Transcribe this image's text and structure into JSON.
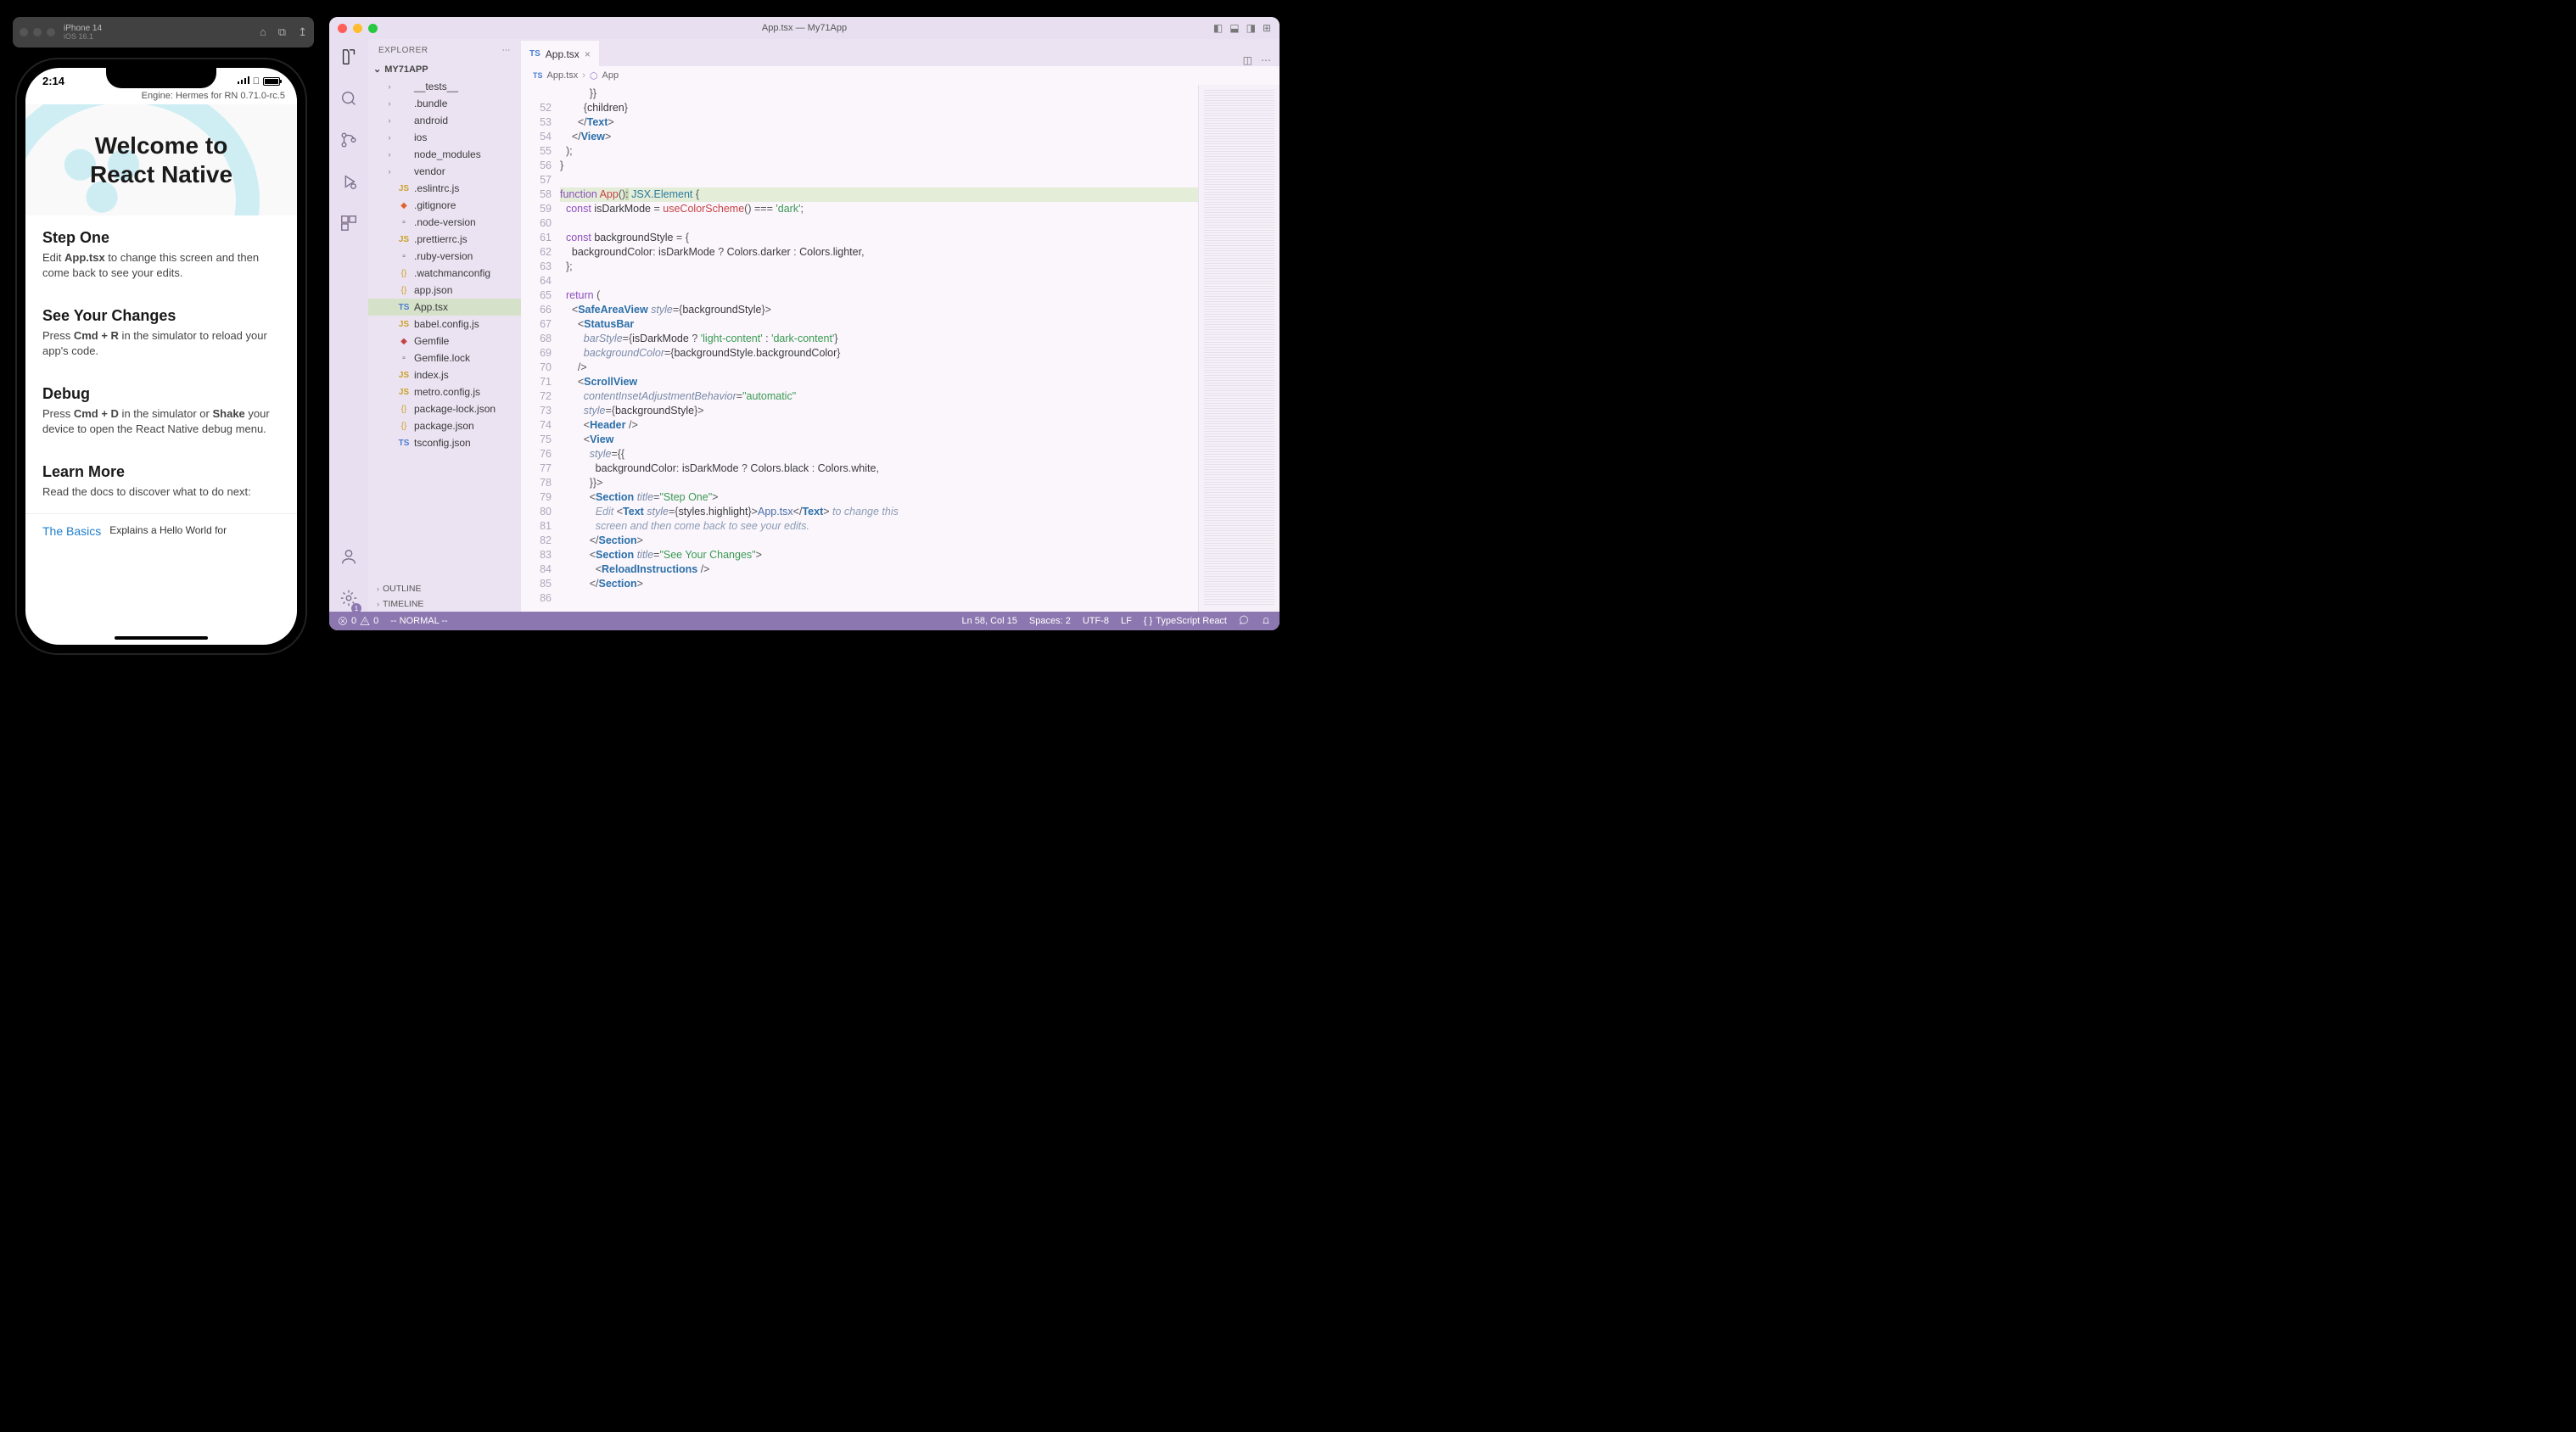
{
  "simulator": {
    "device": "iPhone 14",
    "os": "iOS 16.1"
  },
  "phone": {
    "time": "2:14",
    "engine": "Engine: Hermes for RN 0.71.0-rc.5",
    "hero_l1": "Welcome to",
    "hero_l2": "React Native",
    "sections": [
      {
        "title": "Step One",
        "body_pre": "Edit ",
        "body_b1": "App.tsx",
        "body_post": " to change this screen and then come back to see your edits."
      },
      {
        "title": "See Your Changes",
        "body_pre": "Press ",
        "body_b1": "Cmd + R",
        "body_post": " in the simulator to reload your app's code."
      },
      {
        "title": "Debug",
        "body_pre": "Press ",
        "body_b1": "Cmd + D",
        "body_mid": " in the simulator or ",
        "body_b2": "Shake",
        "body_post": " your device to open the React Native debug menu."
      },
      {
        "title": "Learn More",
        "body_pre": "Read the docs to discover what to do next:",
        "body_b1": "",
        "body_post": ""
      }
    ],
    "footer_link": "The Basics",
    "footer_desc": "Explains a Hello World for"
  },
  "vscode": {
    "title": "App.tsx — My71App",
    "explorer_label": "EXPLORER",
    "project": "MY71APP",
    "outline_label": "OUTLINE",
    "timeline_label": "TIMELINE",
    "tree": [
      {
        "name": "__tests__",
        "kind": "folder"
      },
      {
        "name": ".bundle",
        "kind": "folder"
      },
      {
        "name": "android",
        "kind": "folder"
      },
      {
        "name": "ios",
        "kind": "folder"
      },
      {
        "name": "node_modules",
        "kind": "folder"
      },
      {
        "name": "vendor",
        "kind": "folder"
      },
      {
        "name": ".eslintrc.js",
        "kind": "js"
      },
      {
        "name": ".gitignore",
        "kind": "git"
      },
      {
        "name": ".node-version",
        "kind": "file"
      },
      {
        "name": ".prettierrc.js",
        "kind": "js"
      },
      {
        "name": ".ruby-version",
        "kind": "file"
      },
      {
        "name": ".watchmanconfig",
        "kind": "json"
      },
      {
        "name": "app.json",
        "kind": "json"
      },
      {
        "name": "App.tsx",
        "kind": "ts",
        "selected": true
      },
      {
        "name": "babel.config.js",
        "kind": "js"
      },
      {
        "name": "Gemfile",
        "kind": "rb"
      },
      {
        "name": "Gemfile.lock",
        "kind": "file"
      },
      {
        "name": "index.js",
        "kind": "js"
      },
      {
        "name": "metro.config.js",
        "kind": "js"
      },
      {
        "name": "package-lock.json",
        "kind": "json"
      },
      {
        "name": "package.json",
        "kind": "json"
      },
      {
        "name": "tsconfig.json",
        "kind": "ts"
      }
    ],
    "tab": {
      "name": "App.tsx"
    },
    "breadcrumb": {
      "file": "App.tsx",
      "symbol": "App"
    },
    "line_start": 52,
    "line_count": 35,
    "code_html": [
      "        <span class='op'>{</span>children<span class='op'>}</span>",
      "      <span class='op'>&lt;/</span><span class='tagn'>Text</span><span class='op'>&gt;</span>",
      "    <span class='op'>&lt;/</span><span class='tagn'>View</span><span class='op'>&gt;</span>",
      "  <span class='op'>);</span>",
      "<span class='op'>}</span>",
      "",
      "<span class='kw'>function</span> <span class='fn'>App</span><span class='op'>()</span><span style='background:#c7d7b8;'>:</span> <span class='typ'>JSX</span><span class='op'>.</span><span class='typ'>Element</span> <span class='op'>{</span>",
      "  <span class='kw'>const</span> isDarkMode <span class='op'>=</span> <span class='fn'>useColorScheme</span><span class='op'>()</span> <span class='op'>===</span> <span class='str'>'dark'</span><span class='op'>;</span>",
      "",
      "  <span class='kw'>const</span> backgroundStyle <span class='op'>=</span> <span class='op'>{</span>",
      "    backgroundColor<span class='op'>:</span> isDarkMode <span class='op'>?</span> Colors<span class='op'>.</span>darker <span class='op'>:</span> Colors<span class='op'>.</span>lighter<span class='op'>,</span>",
      "  <span class='op'>};</span>",
      "",
      "  <span class='kw'>return</span> <span class='op'>(</span>",
      "    <span class='op'>&lt;</span><span class='tagn'>SafeAreaView</span> <span class='attr'>style</span><span class='op'>={</span>backgroundStyle<span class='op'>}&gt;</span>",
      "      <span class='op'>&lt;</span><span class='tagn'>StatusBar</span>",
      "        <span class='attr'>barStyle</span><span class='op'>={</span>isDarkMode <span class='op'>?</span> <span class='str'>'light-content'</span> <span class='op'>:</span> <span class='str'>'dark-content'</span><span class='op'>}</span>",
      "        <span class='attr'>backgroundColor</span><span class='op'>={</span>backgroundStyle<span class='op'>.</span>backgroundColor<span class='op'>}</span>",
      "      <span class='op'>/&gt;</span>",
      "      <span class='op'>&lt;</span><span class='tagn'>ScrollView</span>",
      "        <span class='attr'>contentInsetAdjustmentBehavior</span><span class='op'>=</span><span class='str'>&quot;automatic&quot;</span>",
      "        <span class='attr'>style</span><span class='op'>={</span>backgroundStyle<span class='op'>}&gt;</span>",
      "        <span class='op'>&lt;</span><span class='tagn'>Header</span> <span class='op'>/&gt;</span>",
      "        <span class='op'>&lt;</span><span class='tagn'>View</span>",
      "          <span class='attr'>style</span><span class='op'>={{</span>",
      "            backgroundColor<span class='op'>:</span> isDarkMode <span class='op'>?</span> Colors<span class='op'>.</span>black <span class='op'>:</span> Colors<span class='op'>.</span>white<span class='op'>,</span>",
      "          <span class='op'>}}&gt;</span>",
      "          <span class='op'>&lt;</span><span class='tagn'>Section</span> <span class='attr'>title</span><span class='op'>=</span><span class='str'>&quot;Step One&quot;</span><span class='op'>&gt;</span>",
      "            <span class='cmt'>Edit</span> <span class='op'>&lt;</span><span class='tagn'>Text</span> <span class='attr'>style</span><span class='op'>={</span>styles<span class='op'>.</span>highlight<span class='op'>}&gt;</span><span class='id'>App.tsx</span><span class='op'>&lt;/</span><span class='tagn'>Text</span><span class='op'>&gt;</span> <span class='cmt'>to change this</span>",
      "            <span class='cmt'>screen and then come back to see your edits.</span>",
      "          <span class='op'>&lt;/</span><span class='tagn'>Section</span><span class='op'>&gt;</span>",
      "          <span class='op'>&lt;</span><span class='tagn'>Section</span> <span class='attr'>title</span><span class='op'>=</span><span class='str'>&quot;See Your Changes&quot;</span><span class='op'>&gt;</span>",
      "            <span class='op'>&lt;</span><span class='tagn'>ReloadInstructions</span> <span class='op'>/&gt;</span>",
      "          <span class='op'>&lt;/</span><span class='tagn'>Section</span><span class='op'>&gt;</span>",
      ""
    ],
    "status": {
      "errors": "0",
      "warnings": "0",
      "vim_mode": "-- NORMAL --",
      "ln_col": "Ln 58, Col 15",
      "spaces": "Spaces: 2",
      "encoding": "UTF-8",
      "eol": "LF",
      "lang": "TypeScript React"
    }
  }
}
